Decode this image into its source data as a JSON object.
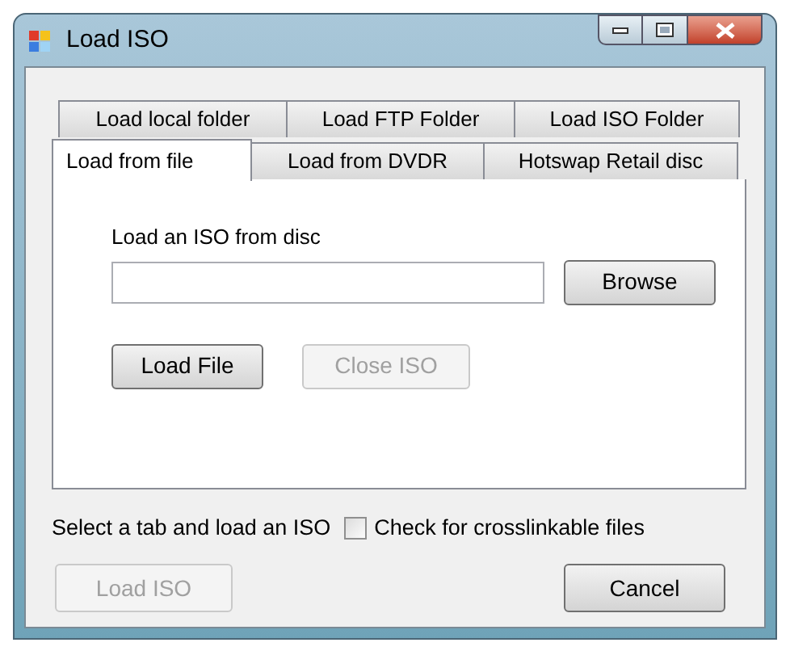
{
  "window": {
    "title": "Load ISO"
  },
  "tab_rows": [
    [
      {
        "label": "Load local folder",
        "selected": false
      },
      {
        "label": "Load FTP Folder",
        "selected": false
      },
      {
        "label": "Load ISO Folder",
        "selected": false
      }
    ],
    [
      {
        "label": "Load from file",
        "selected": true
      },
      {
        "label": "Load from DVDR",
        "selected": false
      },
      {
        "label": "Hotswap Retail disc",
        "selected": false
      }
    ]
  ],
  "panel": {
    "label": "Load an ISO from disc",
    "buttons": [
      {
        "label": "Browse",
        "disabled": false
      },
      {
        "label": "Load File",
        "disabled": false
      },
      {
        "label": "Close ISO",
        "disabled": true
      }
    ]
  },
  "status_text": "Select a tab and load an ISO",
  "crosslink_checkbox": {
    "label": "Check for crosslinkable files",
    "checked": false
  },
  "footer_buttons": [
    {
      "label": "Load ISO",
      "disabled": true
    },
    {
      "label": "Cancel",
      "disabled": false
    }
  ]
}
